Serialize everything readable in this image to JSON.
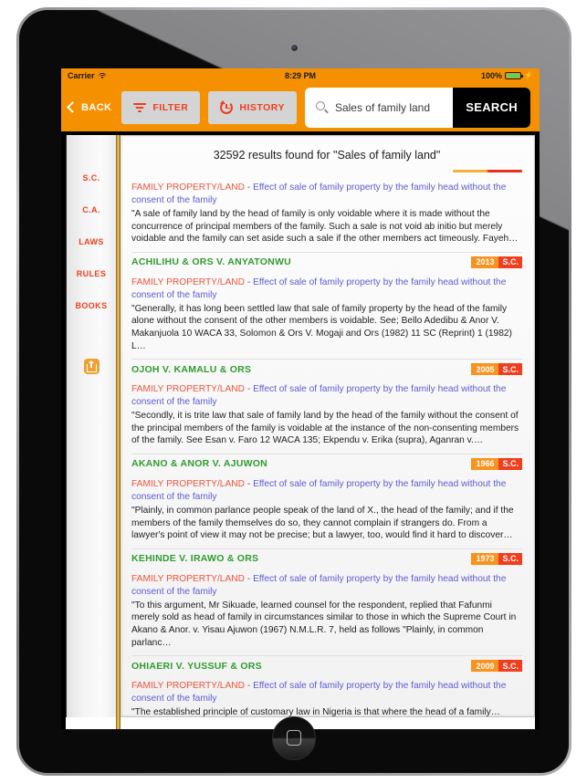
{
  "status_bar": {
    "carrier": "Carrier",
    "wifi_icon": "wifi-icon",
    "time": "8:29 PM",
    "battery_percent": "100%",
    "battery_icon": "battery-icon",
    "charging_icon": "charging-bolt-icon"
  },
  "toolbar": {
    "back_label": "BACK",
    "back_icon": "chevron-left-icon",
    "filter_label": "FILTER",
    "filter_icon": "filter-icon",
    "history_label": "HISTORY",
    "history_icon": "history-clock-icon",
    "search_icon": "search-icon",
    "search_value": "Sales of family land",
    "search_placeholder": "Search",
    "search_button_label": "SEARCH"
  },
  "sidebar": {
    "items": [
      {
        "label": "S.C."
      },
      {
        "label": "C.A."
      },
      {
        "label": "LAWS"
      },
      {
        "label": "RULES"
      },
      {
        "label": "BOOKS"
      }
    ],
    "export_icon": "export-upload-icon"
  },
  "results": {
    "header": "32592 results found for \"Sales of family land\"",
    "count": "32592",
    "query": "Sales of family land",
    "entries": [
      {
        "case_title": "",
        "year": "",
        "court": "",
        "category": "FAMILY PROPERTY/LAND",
        "separator": "-",
        "description": "Effect of sale of family property by the family head without the consent of the family",
        "snippet": "\"A sale of family land by the head of family is only voidable where it is made without the concurrence of principal members of the family. Such a sale is not void ab initio but merely voidable and the family can set aside such a sale if the other members act timeously. Fayeh…"
      },
      {
        "case_title": "ACHILIHU & ORS V. ANYATONWU",
        "year": "2013",
        "court": "S.C.",
        "category": "FAMILY PROPERTY/LAND",
        "separator": "-",
        "description": "Effect of sale of family property by the family head without the consent of the family",
        "snippet": "\"Generally, it has long been settled law that sale of family property by the head of the family alone without the consent of the other members is voidable. See; Bello Adedibu & Anor V. Makanjuola 10 WACA 33, Solomon & Ors V. Mogaji and Ors (1982) 11 SC (Reprint) 1 (1982) L…"
      },
      {
        "case_title": "OJOH V. KAMALU & ORS",
        "year": "2005",
        "court": "S.C.",
        "category": "FAMILY PROPERTY/LAND",
        "separator": "-",
        "description": "Effect of sale of family property by the family head without the consent of the family",
        "snippet": "\"Secondly, it is trite law that sale of family land by the head of the family without the consent of the principal members of the family is voidable at the instance of the non-consenting members of the family. See Esan v. Faro 12 WACA 135; Ekpendu v. Erika (supra), Aganran v.…"
      },
      {
        "case_title": "AKANO & ANOR V. AJUWON",
        "year": "1966",
        "court": "S.C.",
        "category": "FAMILY PROPERTY/LAND",
        "separator": "-",
        "description": "Effect of sale of family property by the family head without the consent of the family",
        "snippet": "\"Plainly, in common parlance people speak of the land of X., the head of the family; and if the members of the family themselves do so, they cannot complain if strangers do. From a lawyer's point of view it may not be precise; but a lawyer, too, would find it hard to discover…"
      },
      {
        "case_title": "KEHINDE V. IRAWO & ORS",
        "year": "1973",
        "court": "S.C.",
        "category": "FAMILY PROPERTY/LAND",
        "separator": "-",
        "description": "Effect of sale of family property by the family head without the consent of the family",
        "snippet": "\"To this argument, Mr Sikuade, learned counsel for the respondent, replied that Fafunmi merely sold as head of family in circumstances similar to those in which the Supreme Court in Akano & Anor. v. Yisau Ajuwon (1967) N.M.L.R. 7, held as follows \"Plainly, in common parlanc…"
      },
      {
        "case_title": "OHIAERI V. YUSSUF & ORS",
        "year": "2009",
        "court": "S.C.",
        "category": "FAMILY PROPERTY/LAND",
        "separator": "-",
        "description": "Effect of sale of family property by the family head without the consent of the family",
        "snippet": "\"The established principle of customary law in Nigeria is that where the head of a family…"
      }
    ]
  },
  "device": {
    "home_button_icon": "home-square-icon",
    "camera_icon": "front-camera-icon"
  },
  "colors": {
    "brand_orange": "#f59100",
    "accent_red": "#f03e1e",
    "case_green": "#2e9c2e",
    "link_blue": "#5b5bd6",
    "badge_year": "#f7931e"
  }
}
